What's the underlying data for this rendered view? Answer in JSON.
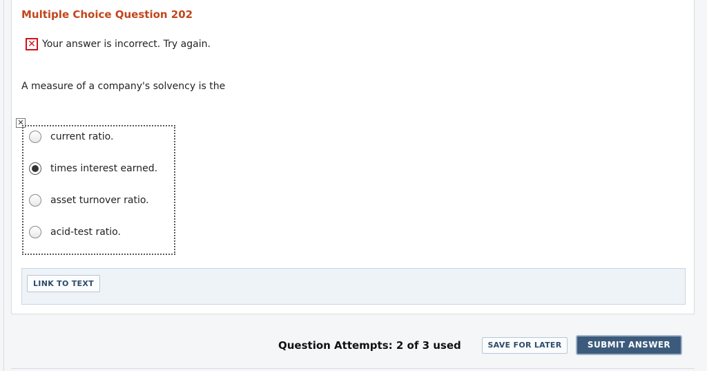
{
  "question": {
    "title": "Multiple Choice Question 202",
    "feedback_icon": "x-mark-icon",
    "feedback_text": "Your answer is incorrect.  Try again.",
    "prompt": "A measure of a company's solvency is the",
    "mark_icon_glyph": "✕",
    "choices": [
      {
        "label": "current ratio.",
        "selected": false
      },
      {
        "label": "times interest earned.",
        "selected": true
      },
      {
        "label": "asset turnover ratio.",
        "selected": false
      },
      {
        "label": "acid-test ratio.",
        "selected": false
      }
    ]
  },
  "resources": {
    "link_to_text_label": "LINK TO TEXT"
  },
  "footer": {
    "attempts_text": "Question Attempts: 2 of 3 used",
    "save_label": "SAVE FOR LATER",
    "submit_label": "SUBMIT ANSWER"
  },
  "colors": {
    "title": "#c1461a",
    "error": "#d0101b",
    "submit_bg": "#3c5b7c",
    "link_text": "#2d4a6b"
  }
}
